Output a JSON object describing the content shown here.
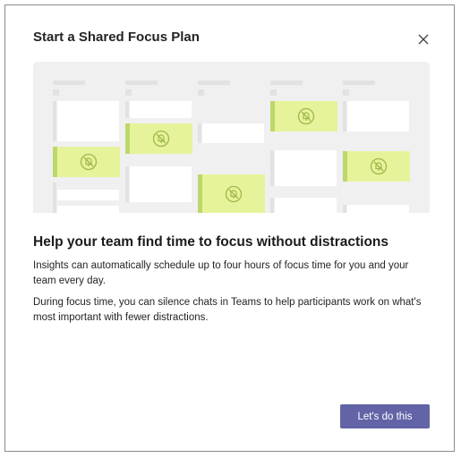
{
  "dialog": {
    "title": "Start a Shared Focus Plan",
    "close_icon": "close-icon",
    "headline": "Help your team find time to focus without distractions",
    "paragraphs": [
      "Insights can automatically schedule up to four hours of focus time for you and your team every day.",
      "During focus time, you can silence chats in Teams to help participants work on what's most important with fewer distractions."
    ],
    "primary_button": "Let's do this"
  },
  "illustration": {
    "focus_block_icon": "muted-bell-icon",
    "colors": {
      "background": "#f0f0f0",
      "focus_fill": "#e7f39a",
      "focus_edge": "#bdd86a",
      "primary": "#6264a7"
    }
  }
}
